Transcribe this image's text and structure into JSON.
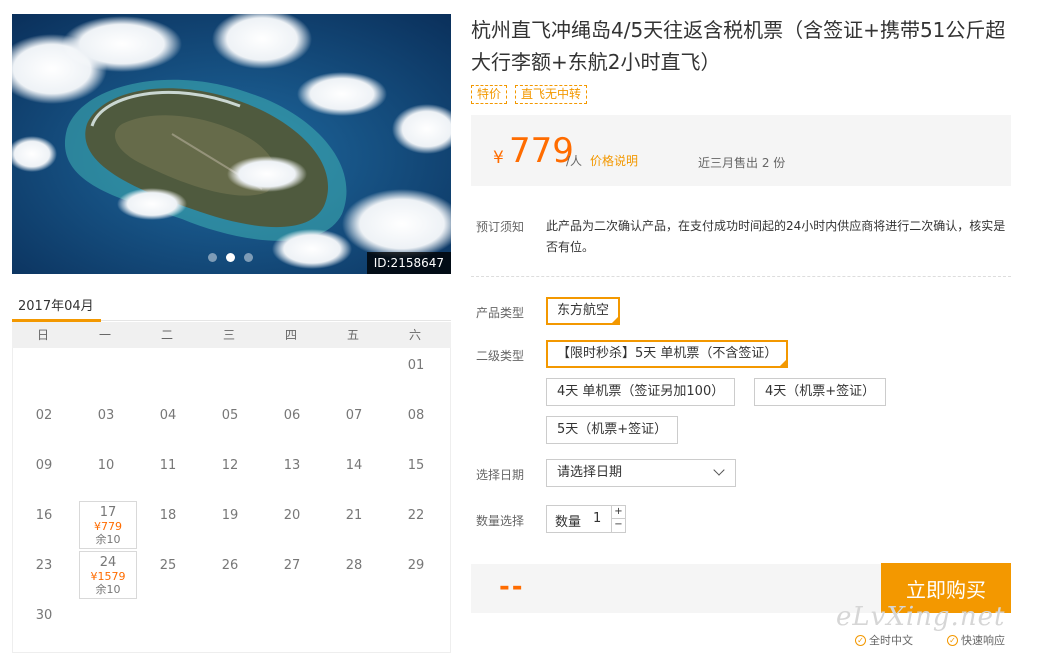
{
  "hero": {
    "image_id": "ID:2158647",
    "slide_count": 3,
    "active_slide": 1
  },
  "calendar": {
    "month_label": "2017年04月",
    "weekdays": [
      "日",
      "一",
      "二",
      "三",
      "四",
      "五",
      "六"
    ],
    "rows": [
      [
        null,
        null,
        null,
        null,
        null,
        null,
        {
          "day": "01"
        }
      ],
      [
        {
          "day": "02"
        },
        {
          "day": "03"
        },
        {
          "day": "04"
        },
        {
          "day": "05"
        },
        {
          "day": "06"
        },
        {
          "day": "07"
        },
        {
          "day": "08"
        }
      ],
      [
        {
          "day": "09"
        },
        {
          "day": "10"
        },
        {
          "day": "11"
        },
        {
          "day": "12"
        },
        {
          "day": "13"
        },
        {
          "day": "14"
        },
        {
          "day": "15"
        }
      ],
      [
        {
          "day": "16"
        },
        {
          "day": "17",
          "price": "¥779",
          "stock": "余10"
        },
        {
          "day": "18"
        },
        {
          "day": "19"
        },
        {
          "day": "20"
        },
        {
          "day": "21"
        },
        {
          "day": "22"
        }
      ],
      [
        {
          "day": "23"
        },
        {
          "day": "24",
          "price": "¥1579",
          "stock": "余10"
        },
        {
          "day": "25"
        },
        {
          "day": "26"
        },
        {
          "day": "27"
        },
        {
          "day": "28"
        },
        {
          "day": "29"
        }
      ],
      [
        {
          "day": "30"
        },
        null,
        null,
        null,
        null,
        null,
        null
      ]
    ]
  },
  "product": {
    "title": "杭州直飞冲绳岛4/5天往返含税机票（含签证+携带51公斤超大行李额+东航2小时直飞）",
    "tags": [
      "特价",
      "直飞无中转"
    ],
    "price": {
      "currency": "¥",
      "amount": "779",
      "unit": "/人",
      "note_link": "价格说明"
    },
    "sold_text": "近三月售出 2 份",
    "notice_label": "预订须知",
    "notice_text": "此产品为二次确认产品，在支付成功时间起的24小时内供应商将进行二次确认，核实是否有位。"
  },
  "options": {
    "type_label": "产品类型",
    "types": [
      "东方航空"
    ],
    "selected_type": 0,
    "subtype_label": "二级类型",
    "subtypes": [
      "【限时秒杀】5天 单机票（不含签证）",
      "4天 单机票（签证另加100）",
      "4天（机票+签证）",
      "5天（机票+签证）"
    ],
    "selected_subtype": 0,
    "date_label": "选择日期",
    "date_placeholder": "请选择日期",
    "qty_label": "数量选择",
    "qty_inner_label": "数量",
    "qty_value": "1",
    "qty_plus": "+",
    "qty_minus": "−"
  },
  "purchase": {
    "total": "--",
    "buy_label": "立即购买"
  },
  "footer": {
    "watermark": "eLvXing.net",
    "features": [
      {
        "icon": "check-circle-icon",
        "label": "全时中文"
      },
      {
        "icon": "check-circle-icon",
        "label": "快速响应"
      }
    ]
  },
  "colors": {
    "accent": "#f39800",
    "price": "#ff6c00"
  }
}
